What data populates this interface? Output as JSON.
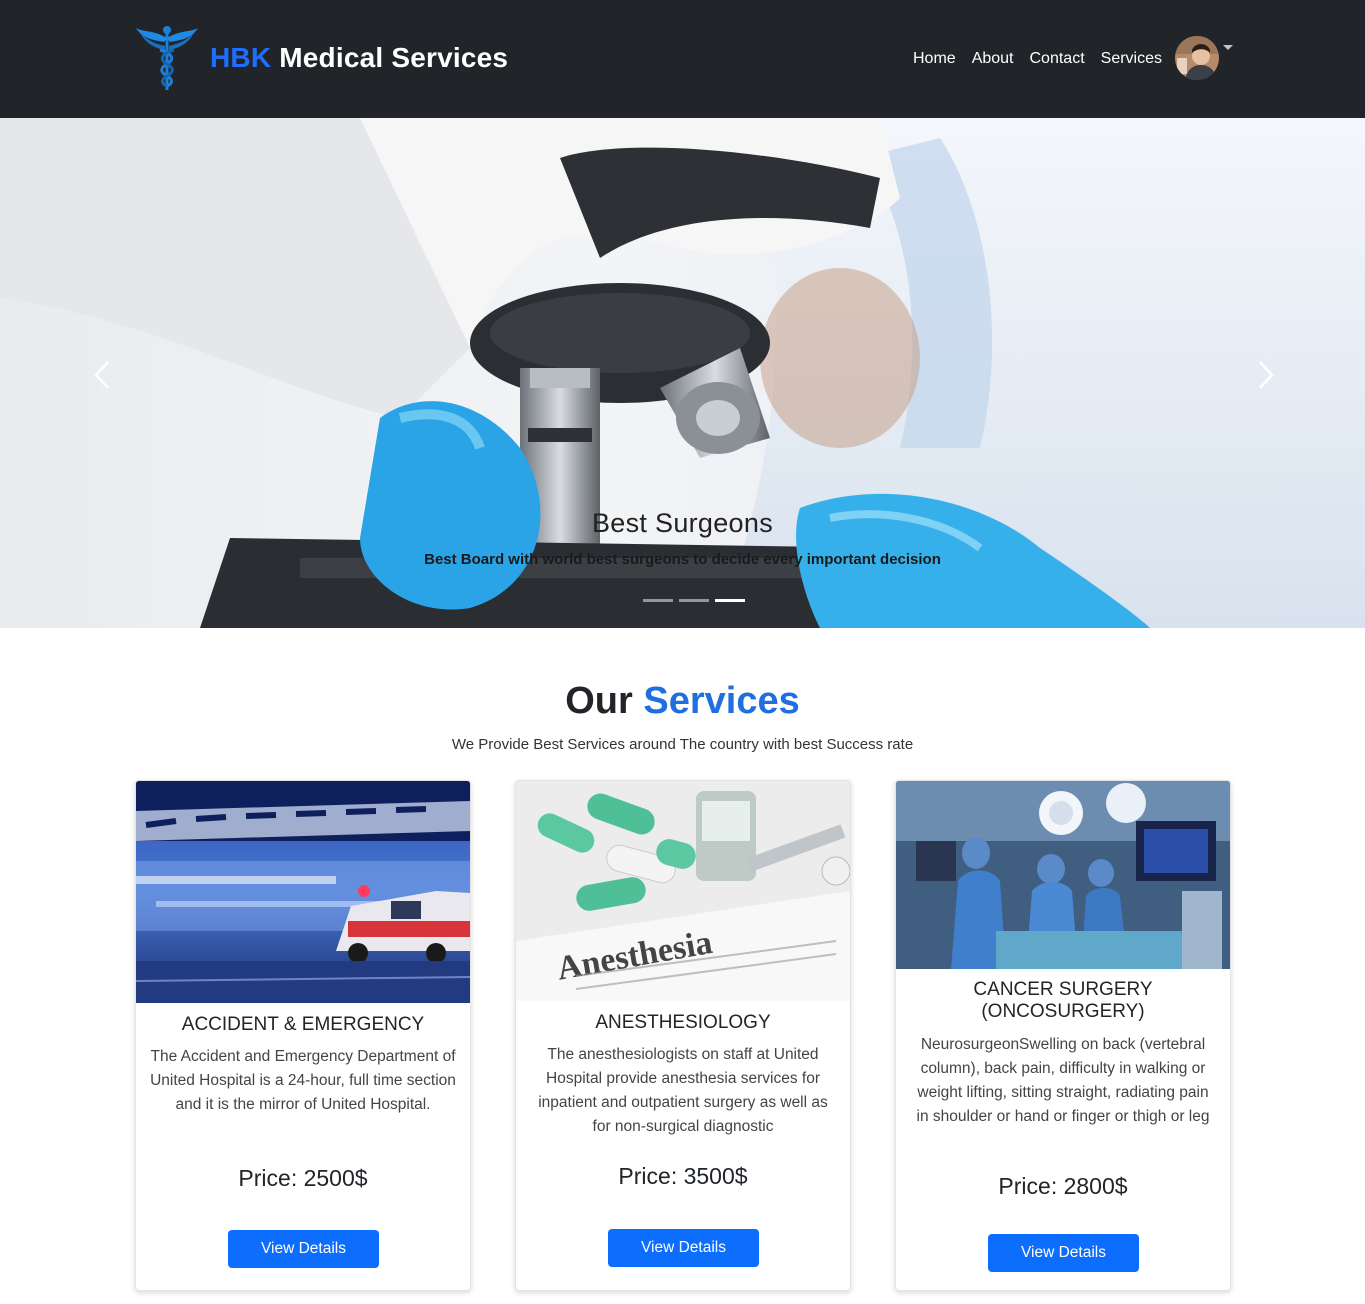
{
  "navbar": {
    "brand_accent": "HBK",
    "brand_rest": " Medical Services",
    "links": [
      "Home",
      "About",
      "Contact",
      "Services"
    ]
  },
  "hero": {
    "title": "Best Surgeons",
    "subtitle": "Best Board with world best surgeons to decide every important decision"
  },
  "services": {
    "title_plain": "Our ",
    "title_accent": "Services",
    "subtitle": "We Provide Best Services around The country with best Success rate",
    "cards": [
      {
        "title": "ACCIDENT & EMERGENCY",
        "text": "The Accident and Emergency Department of United Hospital is a 24-hour, full time section and it is the mirror of United Hospital.",
        "price": "Price: 2500$",
        "button": "View Details"
      },
      {
        "title": "ANESTHESIOLOGY",
        "image_text": "Anesthesia",
        "text": "The anesthesiologists on staff at United Hospital provide anesthesia services for inpatient and outpatient surgery as well as for non-surgical diagnostic",
        "price": "Price: 3500$",
        "button": "View Details"
      },
      {
        "title": "CANCER SURGERY (ONCOSURGERY)",
        "text": "NeurosurgeonSwelling on back (vertebral column), back pain, difficulty in walking or weight lifting, sitting straight, radiating pain in shoulder or hand or finger or thigh or leg",
        "price": "Price: 2800$",
        "button": "View Details"
      }
    ]
  },
  "colors": {
    "navbar_bg": "#212529",
    "accent": "#1f6fe0",
    "button": "#0d6efd"
  },
  "icons": {
    "logo": "caduceus-logo",
    "prev": "chevron-left-icon",
    "next": "chevron-right-icon",
    "caret": "caret-down-icon"
  }
}
